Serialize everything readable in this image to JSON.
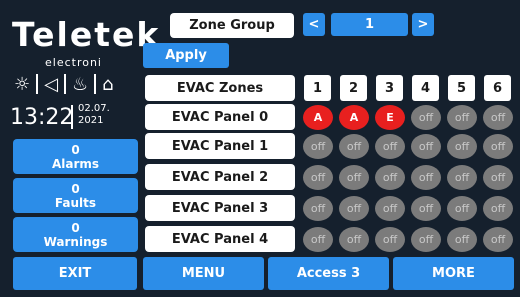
{
  "brand": {
    "name": "Teletek",
    "sub": "electroni"
  },
  "status_icons": [
    "sun-icon",
    "speaker-icon",
    "flame-icon",
    "door-icon"
  ],
  "clock": {
    "time": "13:22",
    "date_line1": "02.07.",
    "date_line2": "2021"
  },
  "counters": [
    {
      "value": "0",
      "label": "Alarms"
    },
    {
      "value": "0",
      "label": "Faults"
    },
    {
      "value": "0",
      "label": "Warnings"
    }
  ],
  "header": {
    "zone_group_label": "Zone Group",
    "prev_symbol": "<",
    "group_value": "1",
    "next_symbol": ">",
    "apply_label": "Apply"
  },
  "grid": {
    "corner_label": "EVAC Zones",
    "zones": [
      "1",
      "2",
      "3",
      "4",
      "5",
      "6"
    ],
    "rows": [
      {
        "name": "EVAC Panel 0",
        "cells": [
          "A",
          "A",
          "E",
          "off",
          "off",
          "off"
        ]
      },
      {
        "name": "EVAC Panel 1",
        "cells": [
          "off",
          "off",
          "off",
          "off",
          "off",
          "off"
        ]
      },
      {
        "name": "EVAC Panel 2",
        "cells": [
          "off",
          "off",
          "off",
          "off",
          "off",
          "off"
        ]
      },
      {
        "name": "EVAC Panel 3",
        "cells": [
          "off",
          "off",
          "off",
          "off",
          "off",
          "off"
        ]
      },
      {
        "name": "EVAC Panel 4",
        "cells": [
          "off",
          "off",
          "off",
          "off",
          "off",
          "off"
        ]
      }
    ]
  },
  "footer": {
    "exit_label": "EXIT",
    "menu_label": "MENU",
    "access_label": "Access 3",
    "more_label": "MORE"
  },
  "colors": {
    "background": "#15202d",
    "accent": "#2c8de8",
    "active": "#e8201f",
    "off": "#7b7b7b"
  }
}
